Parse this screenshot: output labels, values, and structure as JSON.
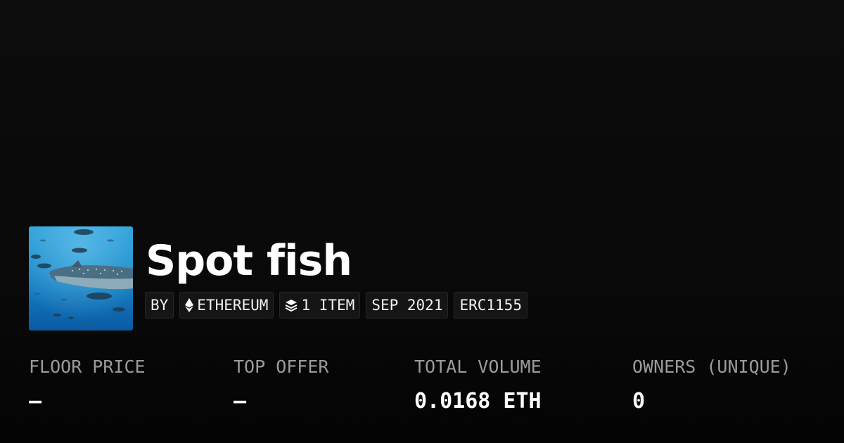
{
  "collection": {
    "name": "Spot fish",
    "avatar_icon": "whale-shark-image"
  },
  "badges": {
    "by_label": "BY",
    "chain_icon": "ethereum-icon",
    "chain_label": "ETHEREUM",
    "items_icon": "layers-icon",
    "items_label": "1 ITEM",
    "date_label": "SEP 2021",
    "standard_label": "ERC1155"
  },
  "stats": {
    "floor_price": {
      "label": "FLOOR PRICE",
      "value": "–"
    },
    "top_offer": {
      "label": "TOP OFFER",
      "value": "–"
    },
    "total_volume": {
      "label": "TOTAL VOLUME",
      "value": "0.0168 ETH"
    },
    "owners": {
      "label": "OWNERS (UNIQUE)",
      "value": "0"
    }
  },
  "colors": {
    "background": "#0a0a0a",
    "badge_background": "#151515",
    "label_gray": "#9b9b9b",
    "text": "#ffffff"
  }
}
